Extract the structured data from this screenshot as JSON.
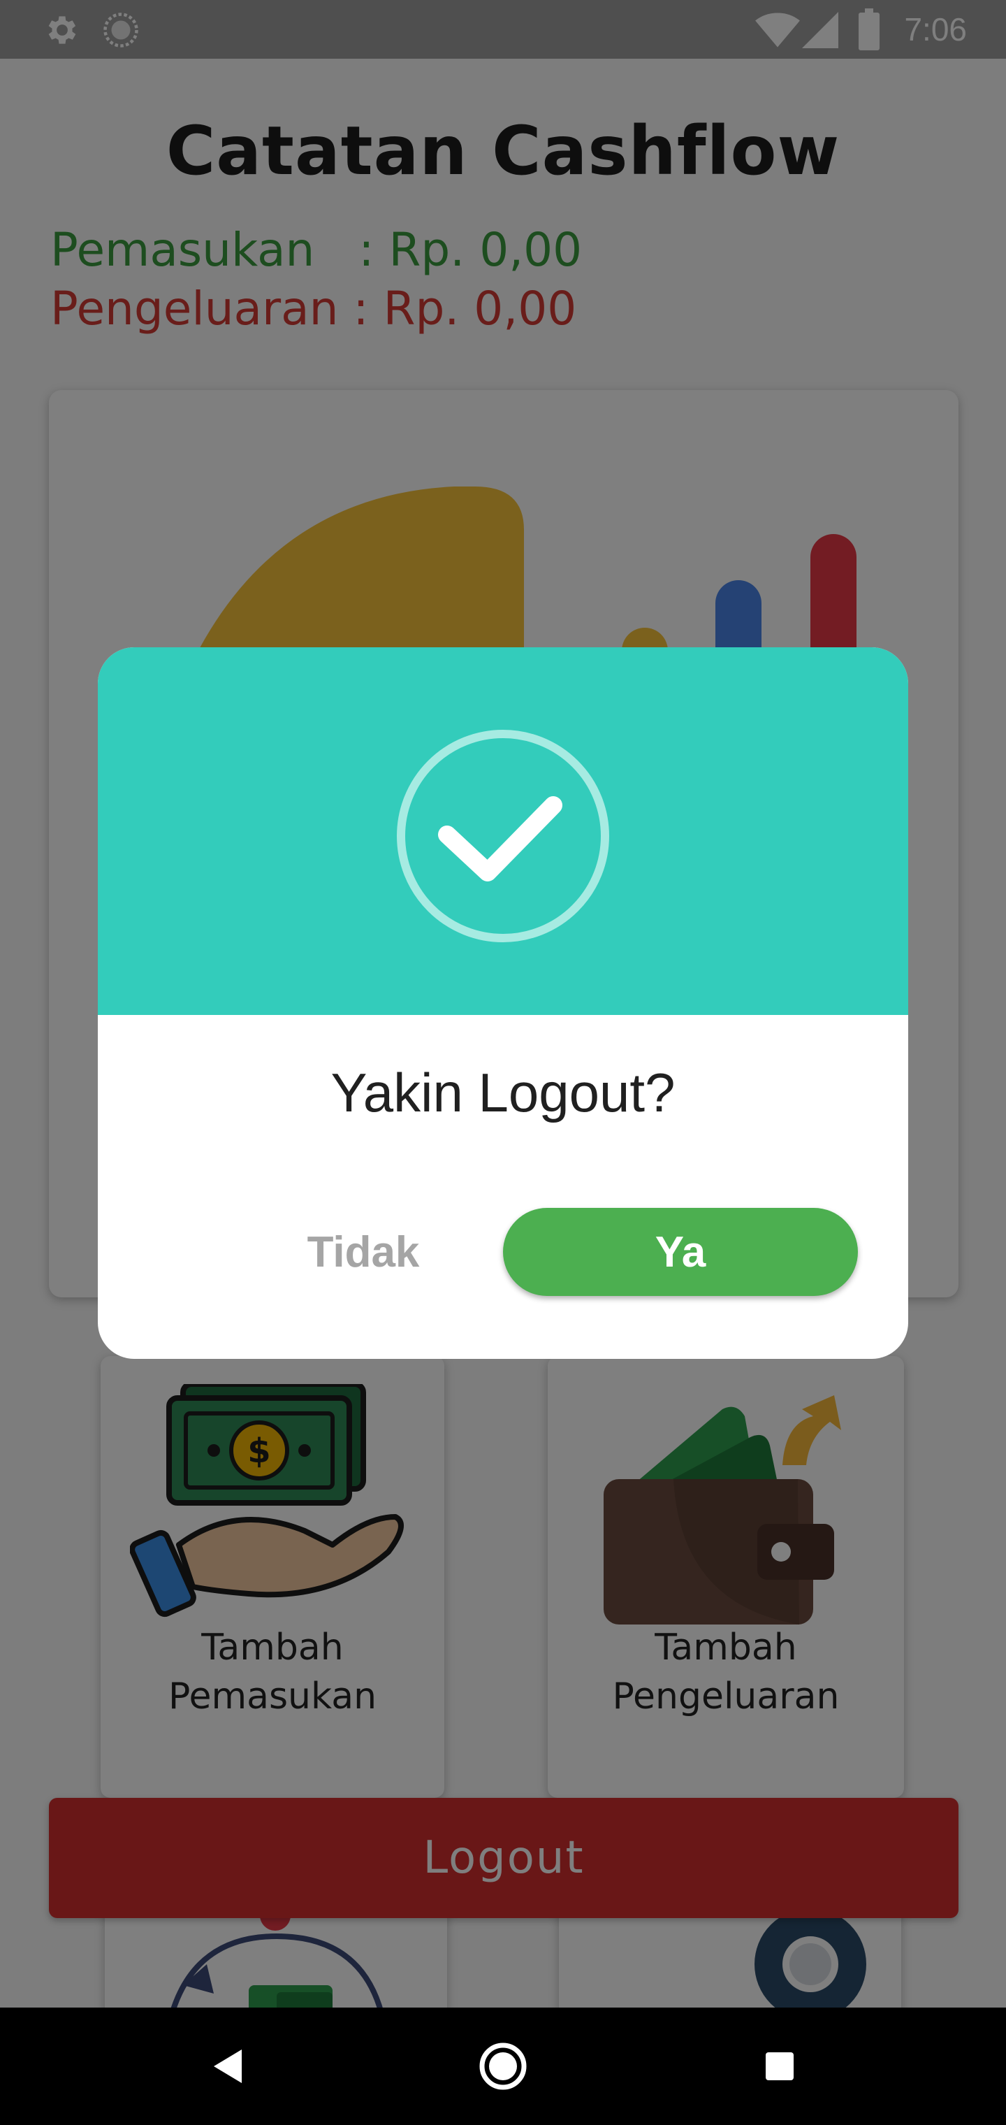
{
  "status_bar": {
    "time": "7:06",
    "icons": [
      "settings-icon",
      "sync-icon",
      "wifi-icon",
      "signal-icon",
      "battery-icon"
    ]
  },
  "app": {
    "title": "Catatan Cashflow",
    "income_label": "Pemasukan   : Rp. 0,00",
    "expense_label": "Pengeluaran : Rp. 0,00"
  },
  "menu": {
    "income_button_line1": "Tambah",
    "income_button_line2": "Pemasukan",
    "expense_button_line1": "Tambah",
    "expense_button_line2": "Pengeluaran"
  },
  "logout_button": "Logout",
  "dialog": {
    "title": "Yakin Logout?",
    "cancel_label": "Tidak",
    "confirm_label": "Ya",
    "header_color": "#33ccbb",
    "icon": "check-circle-icon"
  },
  "navigation": {
    "buttons": [
      "back-icon",
      "home-icon",
      "recents-icon"
    ]
  },
  "colors": {
    "income": "#3a9a3e",
    "expense": "#d23a34",
    "logout": "#d32f2f",
    "confirm": "#4caf50"
  }
}
